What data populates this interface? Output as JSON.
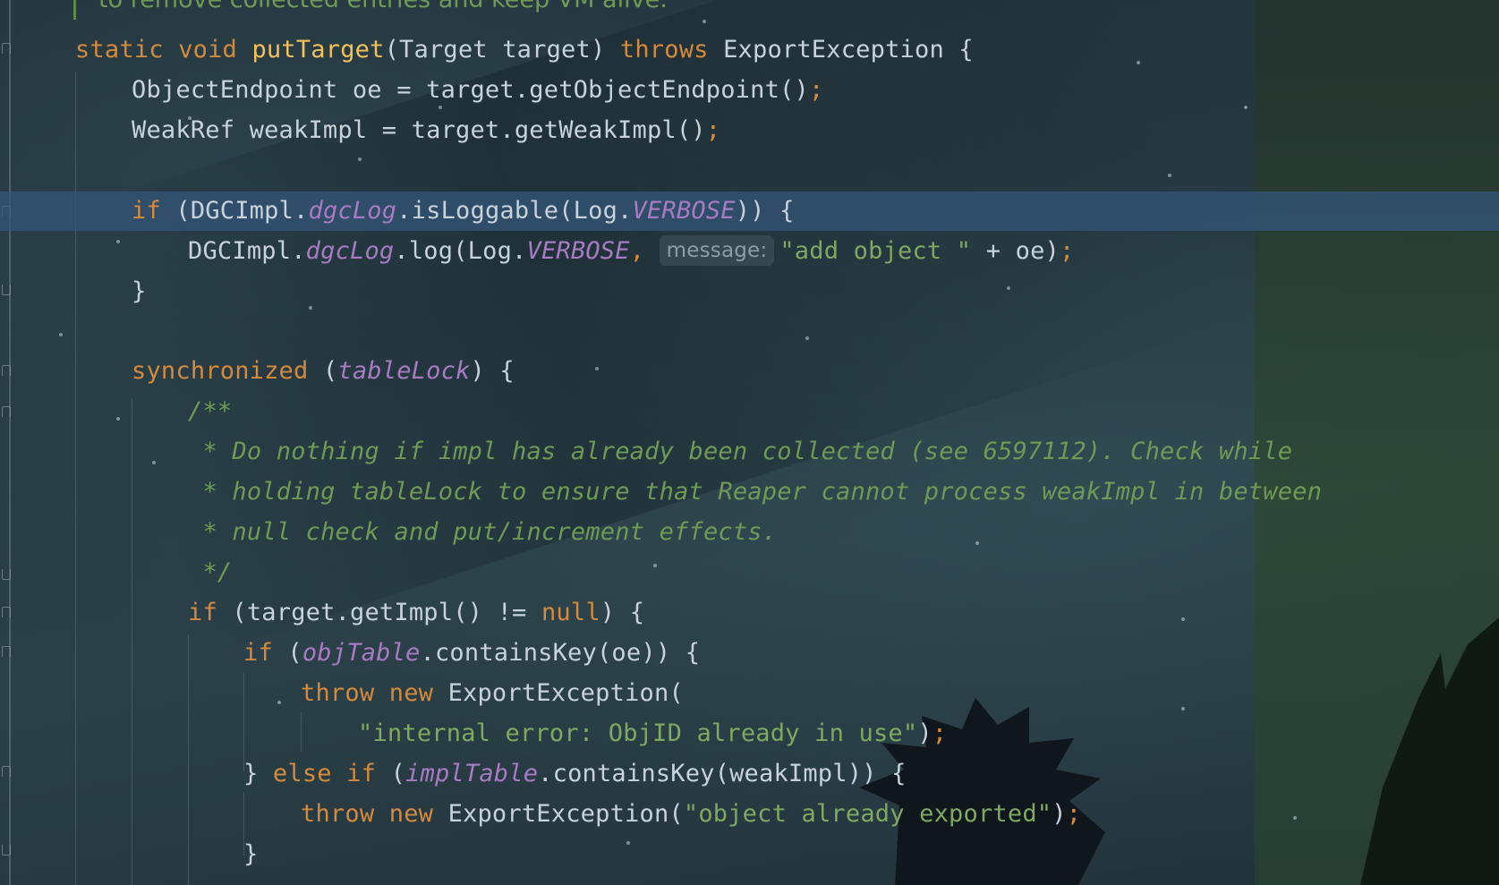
{
  "editor": {
    "top_cut_text": "to remove collected entries and keep VM alive.",
    "lines": [
      {
        "id": "l1",
        "tokens": [
          [
            "kw",
            "static void "
          ],
          [
            "fn",
            "putTarget"
          ],
          [
            "plain",
            "(Target target) "
          ],
          [
            "kw",
            "throws "
          ],
          [
            "plain",
            "ExportException {"
          ]
        ]
      },
      {
        "id": "l2",
        "tokens": [
          [
            "plain",
            "ObjectEndpoint oe = target.getObjectEndpoint()"
          ],
          [
            "semi",
            ";"
          ]
        ]
      },
      {
        "id": "l3",
        "tokens": [
          [
            "plain",
            "WeakRef weakImpl = target.getWeakImpl()"
          ],
          [
            "semi",
            ";"
          ]
        ]
      },
      {
        "id": "l5",
        "tokens": [
          [
            "kw",
            "if "
          ],
          [
            "plain",
            "(DGCImpl."
          ],
          [
            "field",
            "dgcLog"
          ],
          [
            "plain",
            ".isLoggable(Log."
          ],
          [
            "field",
            "VERBOSE"
          ],
          [
            "plain",
            ")) {"
          ]
        ]
      },
      {
        "id": "l6",
        "tokens": [
          [
            "plain",
            "DGCImpl."
          ],
          [
            "field",
            "dgcLog"
          ],
          [
            "plain",
            ".log(Log."
          ],
          [
            "field",
            "VERBOSE"
          ],
          [
            "semi",
            ", "
          ],
          [
            "hint",
            "message:"
          ],
          [
            "str",
            "\"add object \""
          ],
          [
            "plain",
            " + oe)"
          ],
          [
            "semi",
            ";"
          ]
        ]
      },
      {
        "id": "l7",
        "tokens": [
          [
            "plain",
            "}"
          ]
        ]
      },
      {
        "id": "l9",
        "tokens": [
          [
            "kw",
            "synchronized "
          ],
          [
            "plain",
            "("
          ],
          [
            "field",
            "tableLock"
          ],
          [
            "plain",
            ") {"
          ]
        ]
      },
      {
        "id": "l10",
        "tokens": [
          [
            "cm",
            "/**"
          ]
        ]
      },
      {
        "id": "l11",
        "tokens": [
          [
            "cm",
            " * Do nothing if impl has already been collected (see 6597112). Check while"
          ]
        ]
      },
      {
        "id": "l12",
        "tokens": [
          [
            "cm",
            " * holding tableLock to ensure that Reaper cannot process weakImpl in between"
          ]
        ]
      },
      {
        "id": "l13",
        "tokens": [
          [
            "cm",
            " * null check and put/increment effects."
          ]
        ]
      },
      {
        "id": "l14",
        "tokens": [
          [
            "cm",
            " */"
          ]
        ]
      },
      {
        "id": "l15",
        "tokens": [
          [
            "kw",
            "if "
          ],
          [
            "plain",
            "(target.getImpl() != "
          ],
          [
            "kw",
            "null"
          ],
          [
            "plain",
            ") {"
          ]
        ]
      },
      {
        "id": "l16",
        "tokens": [
          [
            "kw",
            "if "
          ],
          [
            "plain",
            "("
          ],
          [
            "field",
            "objTable"
          ],
          [
            "plain",
            ".containsKey(oe)) {"
          ]
        ]
      },
      {
        "id": "l17",
        "tokens": [
          [
            "kw",
            "throw new "
          ],
          [
            "plain",
            "ExportException("
          ]
        ]
      },
      {
        "id": "l18",
        "tokens": [
          [
            "str",
            "\"internal error: ObjID already in use\""
          ],
          [
            "plain",
            ")"
          ],
          [
            "semi",
            ";"
          ]
        ]
      },
      {
        "id": "l19",
        "tokens": [
          [
            "plain",
            "} "
          ],
          [
            "kw",
            "else if "
          ],
          [
            "plain",
            "("
          ],
          [
            "field",
            "implTable"
          ],
          [
            "plain",
            ".containsKey(weakImpl)) {"
          ]
        ]
      },
      {
        "id": "l20",
        "tokens": [
          [
            "kw",
            "throw new "
          ],
          [
            "plain",
            "ExportException("
          ],
          [
            "str",
            "\"object already exported\""
          ],
          [
            "plain",
            ")"
          ],
          [
            "semi",
            ";"
          ]
        ]
      },
      {
        "id": "l21",
        "tokens": [
          [
            "plain",
            "}"
          ]
        ]
      }
    ]
  },
  "colors": {
    "keyword": "#d48a3c",
    "function": "#f2c15a",
    "field": "#a77bc2",
    "string": "#7fa860",
    "comment": "#6f9a55",
    "plain": "#c8d2da",
    "caret_row_highlight": "#345678"
  }
}
